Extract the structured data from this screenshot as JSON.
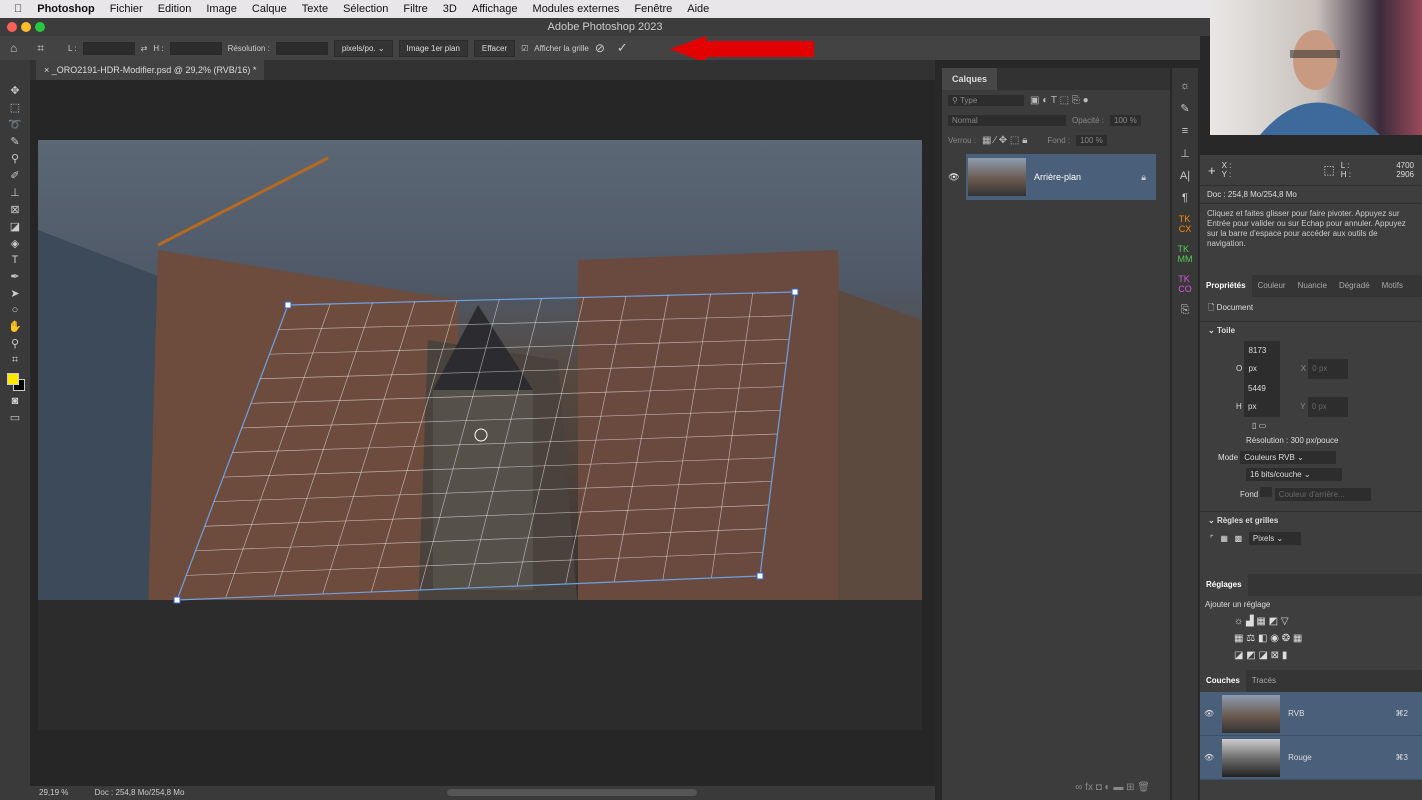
{
  "menubar": {
    "app": "Photoshop",
    "items": [
      "Fichier",
      "Edition",
      "Image",
      "Calque",
      "Texte",
      "Sélection",
      "Filtre",
      "3D",
      "Affichage",
      "Modules externes",
      "Fenêtre",
      "Aide"
    ]
  },
  "window": {
    "title": "Adobe Photoshop 2023"
  },
  "options": {
    "l_label": "L :",
    "h_label": "H :",
    "resolution_label": "Résolution :",
    "unit": "pixels/po.",
    "front_image": "Image 1er plan",
    "clear": "Effacer",
    "show_grid": "Afficher la grille",
    "show_grid_checked": true
  },
  "document_tab": {
    "title": "_ORO2191-HDR-Modifier.psd @ 29,2% (RVB/16) *"
  },
  "status": {
    "zoom": "29,19 %",
    "doc": "Doc : 254,8 Mo/254,8 Mo"
  },
  "layers": {
    "tab": "Calques",
    "filter_placeholder": "Type",
    "blend": "Normal",
    "opacity_label": "Opacité :",
    "opacity": "100 %",
    "lock_label": "Verrou :",
    "fill_label": "Fond :",
    "fill": "100 %",
    "items": [
      {
        "name": "Arrière-plan",
        "visible": true,
        "locked": true
      }
    ]
  },
  "info": {
    "x_label": "X :",
    "y_label": "Y :",
    "l_label": "L :",
    "h_label": "H :",
    "l_value": "4700",
    "h_value": "2906",
    "doc": "Doc : 254,8 Mo/254,8 Mo",
    "hint": "Cliquez et faites glisser pour faire pivoter. Appuyez sur Entrée pour valider ou sur Echap pour annuler. Appuyez sur la barre d'espace pour accéder aux outils de navigation."
  },
  "properties": {
    "tabs": [
      "Propriétés",
      "Couleur",
      "Nuancie",
      "Dégradé",
      "Motifs"
    ],
    "doc_label": "Document",
    "canvas_section": "Toile",
    "w_label": "O",
    "w": "8173 px",
    "h_label": "H",
    "h": "5449 px",
    "x_label": "X",
    "x": "0 px",
    "y_label": "Y",
    "y": "0 px",
    "resolution": "Résolution : 300 px/pouce",
    "mode_label": "Mode",
    "mode": "Couleurs RVB",
    "depth": "16 bits/couche",
    "fill_label": "Fond",
    "fill": "Couleur d'arrière...",
    "rulers_section": "Règles et grilles",
    "units": "Pixels"
  },
  "adjustments": {
    "tab": "Réglages",
    "add": "Ajouter un réglage"
  },
  "channels": {
    "tabs": [
      "Couches",
      "Tracés"
    ],
    "items": [
      {
        "name": "RVB",
        "shortcut": "⌘2"
      },
      {
        "name": "Rouge",
        "shortcut": "⌘3"
      }
    ]
  },
  "colors": {
    "accent_arrow": "#e30000",
    "layer_selected": "#4a5f7a",
    "foreground": "#ffe600",
    "background": "#000000"
  }
}
